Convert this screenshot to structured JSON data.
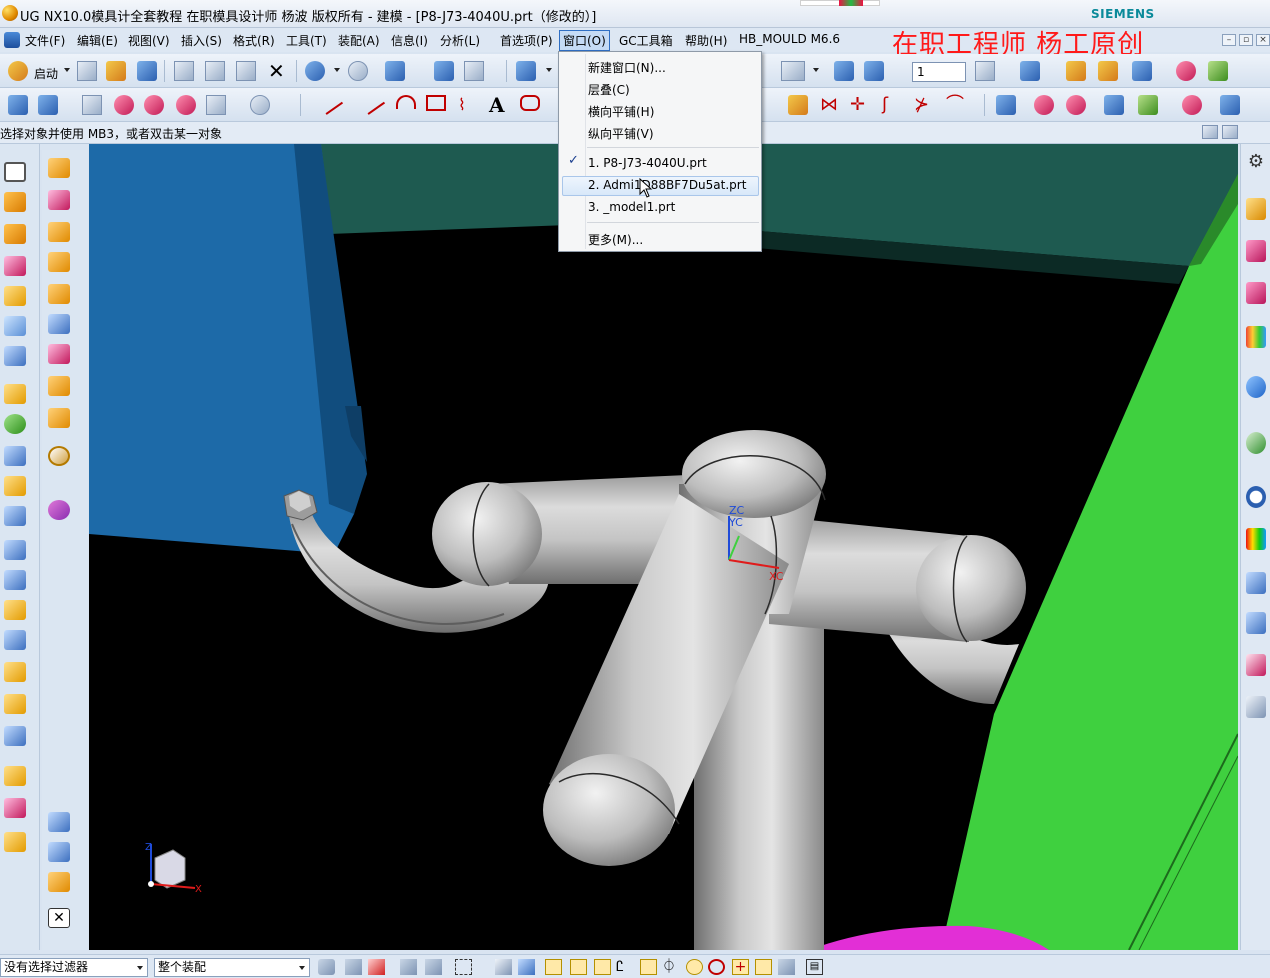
{
  "titlebar": {
    "title": "UG NX10.0模具计全套教程 在职模具设计师 杨波 版权所有 - 建模 - [P8-J73-4040U.prt（修改的）]",
    "brand": "SIEMENS"
  },
  "menubar": {
    "items": [
      {
        "label": "文件(F)"
      },
      {
        "label": "编辑(E)"
      },
      {
        "label": "视图(V)"
      },
      {
        "label": "插入(S)"
      },
      {
        "label": "格式(R)"
      },
      {
        "label": "工具(T)"
      },
      {
        "label": "装配(A)"
      },
      {
        "label": "信息(I)"
      },
      {
        "label": "分析(L)"
      },
      {
        "label": "首选项(P)"
      },
      {
        "label": "窗口(O)"
      },
      {
        "label": "GC工具箱"
      },
      {
        "label": "帮助(H)"
      },
      {
        "label": "HB_MOULD M6.6"
      }
    ],
    "watermark": "在职工程师  杨工原创",
    "window_controls": [
      "–",
      "▫",
      "×"
    ]
  },
  "toolbar_standard": {
    "start_label": "启动",
    "layer_value": "1"
  },
  "cueline": {
    "text": "选择对象并使用 MB3，或者双击某一对象"
  },
  "window_menu": {
    "items": [
      {
        "label": "新建窗口(N)..."
      },
      {
        "label": "层叠(C)"
      },
      {
        "label": "横向平铺(H)"
      },
      {
        "label": "纵向平铺(V)"
      },
      {
        "label": "1. P8-J73-4040U.prt",
        "checked": true
      },
      {
        "label": "2. Admi1D88BF7Du5at.prt",
        "hover": true
      },
      {
        "label": "3. _model1.prt"
      },
      {
        "label": "更多(M)..."
      }
    ]
  },
  "viewport": {
    "wcs_labels": {
      "zc": "ZC",
      "yc": "YC",
      "xc": "XC"
    },
    "triad_labels": {
      "z": "Z",
      "x": "X"
    }
  },
  "statusbar": {
    "filter_value": "没有选择过滤器",
    "scope_value": "整个装配"
  },
  "colors": {
    "accent": "#2f6fc4",
    "watermark": "#ff1a1a",
    "green_plate": "#3fd03f",
    "blue_block": "#1d6aa8",
    "teal_plate": "#1e5a50"
  }
}
